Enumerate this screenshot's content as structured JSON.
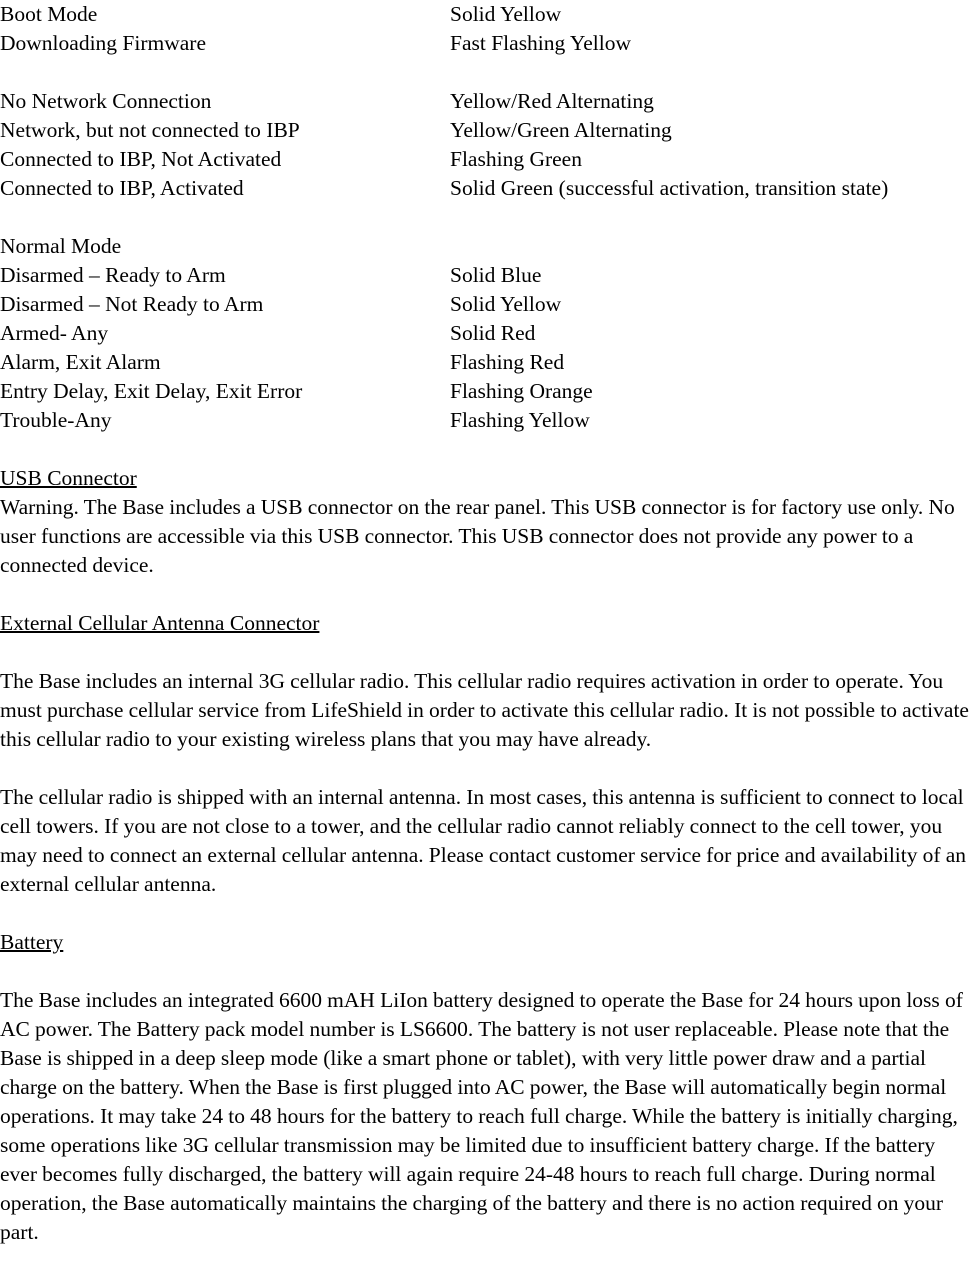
{
  "document": {
    "type": "manual-page",
    "text_color": "#000000",
    "background_color": "#ffffff"
  },
  "led_status_tables": [
    {
      "name": "boot-mode-table",
      "mode_label": "Boot Mode",
      "mode_label_has_indicator": true,
      "mode_label_indicator": "Solid Yellow",
      "rows": [
        {
          "state": "Downloading Firmware",
          "indicator": "Fast Flashing Yellow"
        }
      ]
    },
    {
      "name": "network-status-table",
      "rows": [
        {
          "state": "No Network Connection",
          "indicator": "Yellow/Red Alternating"
        },
        {
          "state": "Network, but not connected to IBP",
          "indicator": "Yellow/Green Alternating"
        },
        {
          "state": "Connected to IBP, Not Activated",
          "indicator": "Flashing Green"
        },
        {
          "state": "Connected to IBP, Activated",
          "indicator": "Solid Green (successful activation, transition state)"
        }
      ]
    },
    {
      "name": "normal-mode-table",
      "mode_label": "Normal Mode",
      "mode_label_has_indicator": false,
      "mode_label_indicator": "",
      "rows": [
        {
          "state": "Disarmed – Ready to Arm",
          "indicator": "Solid Blue"
        },
        {
          "state": "Disarmed – Not Ready to Arm",
          "indicator": "Solid Yellow"
        },
        {
          "state": "Armed- Any",
          "indicator": "Solid Red"
        },
        {
          "state": "Alarm, Exit Alarm",
          "indicator": "Flashing Red"
        },
        {
          "state": "Entry Delay, Exit Delay, Exit Error",
          "indicator": "Flashing Orange"
        },
        {
          "state": "Trouble-Any",
          "indicator": "Flashing Yellow"
        }
      ]
    }
  ],
  "sections": [
    {
      "id": "usb-connector",
      "heading": "USB Connector",
      "paragraphs": [
        "Warning. The Base includes a USB connector on the rear panel. This USB connector is for factory use only. No user functions are accessible via this USB connector. This USB connector does not provide any power to a connected device."
      ]
    },
    {
      "id": "external-cellular-antenna-connector",
      "heading": "External Cellular Antenna Connector",
      "paragraphs": [
        "The Base includes an internal 3G cellular radio. This cellular radio requires activation in order to operate. You must purchase cellular service from LifeShield in order to activate this cellular radio. It is not possible to activate this cellular radio to your existing wireless plans that you may have already.",
        "The cellular radio is shipped with an internal antenna. In most cases, this antenna is sufficient to connect to local cell towers. If you are not close to a tower, and the cellular radio cannot reliably connect to the cell tower, you may need to connect an external cellular antenna. Please contact customer service for price and availability of an external cellular antenna."
      ]
    },
    {
      "id": "battery",
      "heading": "Battery",
      "paragraphs": [
        "The Base includes an integrated 6600 mAH LiIon battery designed to operate the Base for 24 hours upon loss of AC power. The Battery pack model number is LS6600. The battery is not user replaceable. Please note that the Base is shipped in a deep sleep mode (like a smart phone or tablet), with very little power draw and a partial charge on the battery. When the Base is first plugged into AC power, the Base will automatically begin normal operations. It may take 24 to 48 hours for the battery to reach full charge. While the battery is initially charging, some operations like 3G cellular transmission may be limited due to insufficient battery charge. If the battery ever becomes fully discharged, the battery will again require 24-48 hours to reach full charge. During normal operation, the Base automatically maintains the charging of the battery and there is no action required on your part."
      ]
    }
  ]
}
